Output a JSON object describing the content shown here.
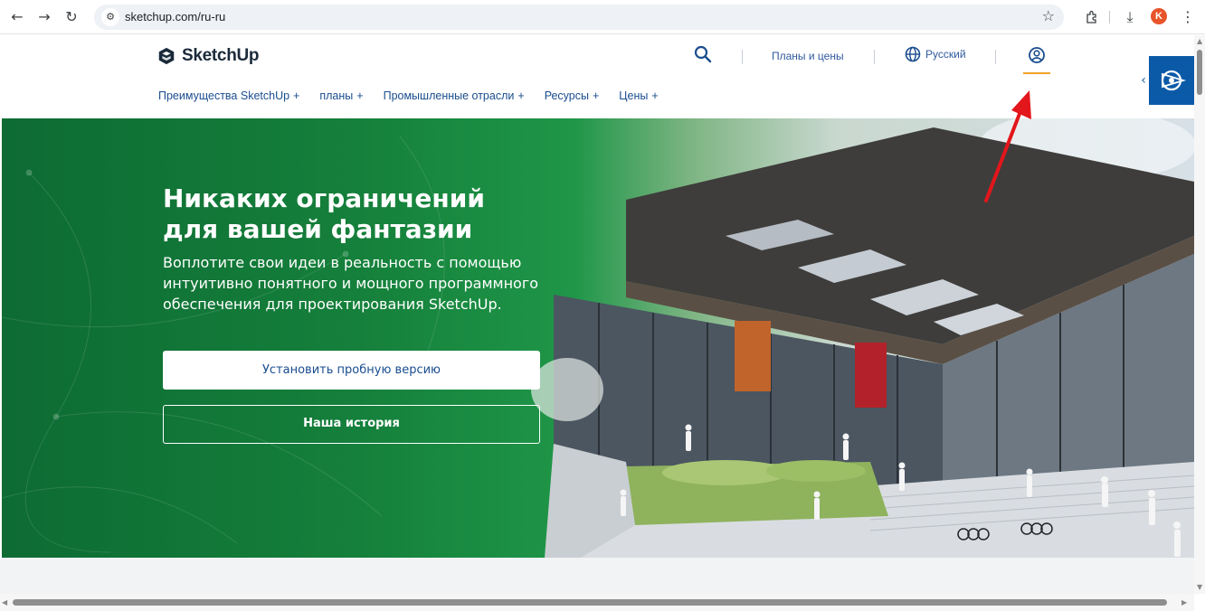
{
  "browser": {
    "back_icon": "arrow-left-icon",
    "forward_icon": "arrow-right-icon",
    "reload_icon": "reload-icon",
    "url": "sketchup.com/ru-ru",
    "profile_initial": "K",
    "profile_color": "#e8542a"
  },
  "header": {
    "logo_text": "SketchUp",
    "plans_link": "Планы и цены",
    "language": "Русский",
    "accent_color": "#f0a32a"
  },
  "nav": {
    "items": [
      {
        "label": "Преимущества SketchUp",
        "plus": "+"
      },
      {
        "label": "планы",
        "plus": "+"
      },
      {
        "label": "Промышленные отрасли",
        "plus": "+"
      },
      {
        "label": "Ресурсы",
        "plus": "+"
      },
      {
        "label": "Цены",
        "plus": "+"
      }
    ]
  },
  "hero": {
    "title_line1": "Никаких ограничений",
    "title_line2": "для вашей фантазии",
    "subtitle": "Воплотите свои идеи в реальность с помощью интуитивно понятного и мощного программного обеспечения для проектирования SketchUp.",
    "primary_button": "Установить пробную версию",
    "secondary_button": "Наша история",
    "brand_green": "#15803b"
  }
}
